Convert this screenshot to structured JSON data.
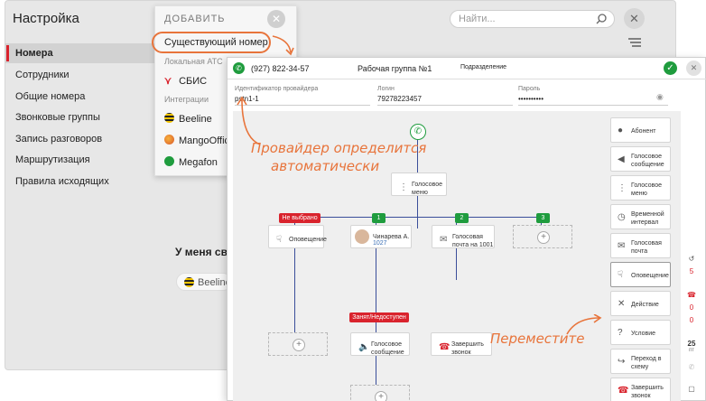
{
  "colors": {
    "accent_red": "#d9232d",
    "green": "#1f9c3e",
    "orange": "#e8743b",
    "line": "#3a4e9a"
  },
  "background": {
    "title": "Настройка",
    "search_placeholder": "Найти...",
    "close_icon": "close-icon",
    "sidebar": [
      "Номера",
      "Сотрудники",
      "Общие номера",
      "Звонковые группы",
      "Запись разговоров",
      "Маршрутизация",
      "Правила исходящих"
    ],
    "main_text": "У меня своя",
    "pill_label": "Beeline"
  },
  "dropdown": {
    "header": "ДОБАВИТЬ",
    "highlighted": "Существующий номер",
    "section_local": "Локальная АТС",
    "local_items": [
      "СБИС"
    ],
    "section_integrations": "Интеграции",
    "integration_items": [
      "Beeline",
      "MangoOffice",
      "Megafon"
    ]
  },
  "panel": {
    "phone": "(927) 822-34-57",
    "group": "Рабочая группа №1",
    "dept": "Подразделение",
    "provider_label": "Идентификатор провайдера",
    "provider_value": "pstn1-1",
    "login_label": "Логин",
    "login_value": "79278223457",
    "password_label": "Пароль",
    "password_value": "••••••••••"
  },
  "flow": {
    "root": "Голосовое\nменю",
    "badges": [
      "Не выбрано",
      "1",
      "2",
      "3",
      "Занят/Недоступен"
    ],
    "nodes": {
      "alert": "Оповещение",
      "person_name": "Чинарева А.",
      "person_ext": "1027",
      "voicemail": "Голосовая\nпочта на 1001",
      "voice_msg": "Голосовое\nсообщение",
      "end_call": "Завершить\nзвонок"
    }
  },
  "annotations": {
    "provider_note_line1": "Провайдер определится",
    "provider_note_line2": "автоматически",
    "move_note": "Переместите"
  },
  "toolbox": [
    "Абонент",
    "Голосовое\nсообщение",
    "Голосовое\nменю",
    "Временной\nинтервал",
    "Голосовая\nпочта",
    "Оповещение",
    "Действие",
    "Условие",
    "Переход в\nсхему",
    "Завершить\nзвонок"
  ],
  "right_strip": {
    "count1": "5",
    "count2": "0",
    "count3": "0",
    "date_day": "25",
    "date_unit": "пт"
  }
}
